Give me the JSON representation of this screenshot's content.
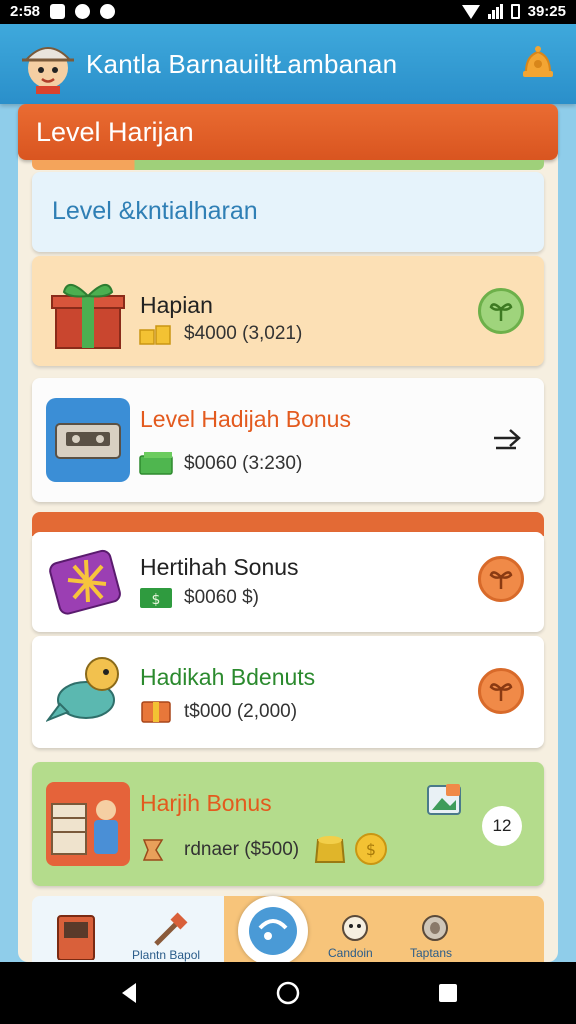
{
  "status_bar": {
    "time": "2:58",
    "clock": "39:25"
  },
  "header": {
    "title": "Kantla BarnauiltŁambanan",
    "avatar_icon": "boy-avatar-icon",
    "bell_icon": "bell-icon"
  },
  "section": {
    "title": "Level Harijan",
    "subtitle": "Level &kntialharan"
  },
  "cards": [
    {
      "title": "Hapian",
      "value": "$4000 (3,021)",
      "icon": "gift-box-icon",
      "action_icon": "plant-icon",
      "title_color": "#222222"
    },
    {
      "title": "Level Hadijah Bonus",
      "value": "$0060 (3:230)",
      "icon": "cassette-icon",
      "action_icon": "arrow-icon",
      "title_color": "#e35a1e"
    },
    {
      "title": "Hertihah Sonus",
      "value": "$0060 $)",
      "icon": "purple-gift-icon",
      "action_icon": "plant-icon",
      "title_color": "#222222"
    },
    {
      "title": "Hadikah Bdenuts",
      "value": "t$000 (2,000)",
      "icon": "bird-icon",
      "action_icon": "plant-icon",
      "title_color": "#2b8a2e"
    },
    {
      "title": "Harjih Bonus",
      "value": "rdnaer ($500)",
      "icon": "shop-icon",
      "badge": "12",
      "title_color": "#e35a1e"
    }
  ],
  "bottom_tabs": [
    {
      "label": "Plantn Bapol",
      "icon": "arcade-icon"
    },
    {
      "label": "Candoin",
      "icon": "cow-icon"
    },
    {
      "label": "Taptans",
      "icon": "egg-icon"
    }
  ],
  "colors": {
    "header": "#2a8fca",
    "accent": "#d95520",
    "card_peach": "#fce0b5",
    "card_green": "#b4dc8c"
  }
}
